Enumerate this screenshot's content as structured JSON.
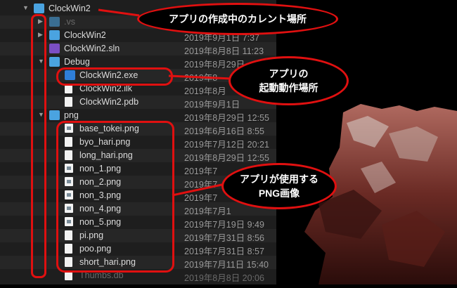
{
  "rows": [
    {
      "name": "ClockWin2",
      "date": "",
      "type": "folder",
      "indent": 0,
      "tri": "▼",
      "dim": false
    },
    {
      "name": ".vs",
      "date": "",
      "type": "folder",
      "indent": 1,
      "tri": "▶",
      "dim": true
    },
    {
      "name": "ClockWin2",
      "date": "2019年9月1日 7:37",
      "type": "folder",
      "indent": 1,
      "tri": "▶",
      "dim": false
    },
    {
      "name": "ClockWin2.sln",
      "date": "2019年8月8日 11:23",
      "type": "sln",
      "indent": 1,
      "tri": "",
      "dim": false
    },
    {
      "name": "Debug",
      "date": "2019年8月29日",
      "type": "folder",
      "indent": 1,
      "tri": "▼",
      "dim": false
    },
    {
      "name": "ClockWin2.exe",
      "date": "2019年8",
      "type": "exe",
      "indent": 2,
      "tri": "",
      "dim": false
    },
    {
      "name": "ClockWin2.ilk",
      "date": "2019年8月",
      "type": "doc",
      "indent": 2,
      "tri": "",
      "dim": false
    },
    {
      "name": "ClockWin2.pdb",
      "date": "2019年9月1日",
      "type": "doc",
      "indent": 2,
      "tri": "",
      "dim": false
    },
    {
      "name": "png",
      "date": "2019年8月29日 12:55",
      "type": "folder",
      "indent": 1,
      "tri": "▼",
      "dim": false
    },
    {
      "name": "base_tokei.png",
      "date": "2019年6月16日 8:55",
      "type": "img",
      "indent": 2,
      "tri": "",
      "dim": false
    },
    {
      "name": "byo_hari.png",
      "date": "2019年7月12日 20:21",
      "type": "doc",
      "indent": 2,
      "tri": "",
      "dim": false
    },
    {
      "name": "long_hari.png",
      "date": "2019年8月29日 12:55",
      "type": "doc",
      "indent": 2,
      "tri": "",
      "dim": false
    },
    {
      "name": "non_1.png",
      "date": "2019年7",
      "type": "img",
      "indent": 2,
      "tri": "",
      "dim": false
    },
    {
      "name": "non_2.png",
      "date": "2019年7",
      "type": "img",
      "indent": 2,
      "tri": "",
      "dim": false
    },
    {
      "name": "non_3.png",
      "date": "2019年7",
      "type": "img",
      "indent": 2,
      "tri": "",
      "dim": false
    },
    {
      "name": "non_4.png",
      "date": "2019年7月1",
      "type": "img",
      "indent": 2,
      "tri": "",
      "dim": false
    },
    {
      "name": "non_5.png",
      "date": "2019年7月19日 9:49",
      "type": "img",
      "indent": 2,
      "tri": "",
      "dim": false
    },
    {
      "name": "pi.png",
      "date": "2019年7月31日 8:56",
      "type": "doc",
      "indent": 2,
      "tri": "",
      "dim": false
    },
    {
      "name": "poo.png",
      "date": "2019年7月31日 8:57",
      "type": "doc",
      "indent": 2,
      "tri": "",
      "dim": false
    },
    {
      "name": "short_hari.png",
      "date": "2019年7月11日 15:40",
      "type": "doc",
      "indent": 2,
      "tri": "",
      "dim": false
    },
    {
      "name": "Thumbs.db",
      "date": "2019年8月8日 20:06",
      "type": "doc",
      "indent": 2,
      "tri": "",
      "dim": true
    }
  ],
  "annotations": {
    "current": "アプリの作成中のカレント場所",
    "startup_line1": "アプリの",
    "startup_line2": "起動動作場所",
    "png_line1": "アプリが使用する",
    "png_line2": "PNG画像"
  },
  "colors": {
    "accent": "#e01010",
    "folder": "#4aa3e0"
  }
}
